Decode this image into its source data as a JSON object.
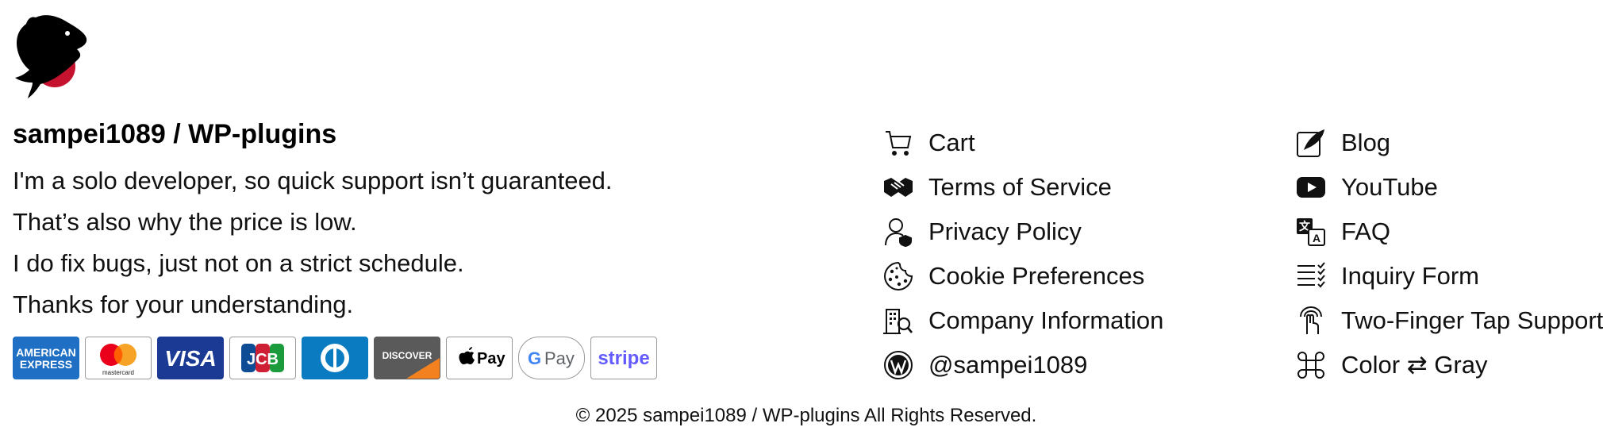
{
  "site": {
    "title": "sampei1089 / WP-plugins",
    "description": [
      "I'm a solo developer, so quick support isn’t guaranteed.",
      "That’s also why the price is low.",
      "I do fix bugs, just not on a strict schedule.",
      "Thanks for your understanding."
    ]
  },
  "payments": [
    {
      "name": "American Express",
      "icon": "amex-icon"
    },
    {
      "name": "Mastercard",
      "icon": "mastercard-icon",
      "text": "mastercard"
    },
    {
      "name": "Visa",
      "icon": "visa-icon",
      "text": "VISA"
    },
    {
      "name": "JCB",
      "icon": "jcb-icon",
      "text": "JCB"
    },
    {
      "name": "Diners Club",
      "icon": "diners-icon"
    },
    {
      "name": "Discover",
      "icon": "discover-icon",
      "text": "DISCOVER"
    },
    {
      "name": "Apple Pay",
      "icon": "apple-pay-icon",
      "text": "Pay"
    },
    {
      "name": "Google Pay",
      "icon": "google-pay-icon",
      "text": "Pay"
    },
    {
      "name": "Stripe",
      "icon": "stripe-icon",
      "text": "stripe"
    }
  ],
  "amex": {
    "line1": "AMERICAN",
    "line2": "EXPRESS"
  },
  "nav": {
    "col1": [
      {
        "label": "Cart",
        "icon": "cart-icon"
      },
      {
        "label": "Terms of Service",
        "icon": "handshake-icon"
      },
      {
        "label": "Privacy Policy",
        "icon": "user-shield-icon"
      },
      {
        "label": "Cookie Preferences",
        "icon": "cookie-icon"
      },
      {
        "label": "Company Information",
        "icon": "building-search-icon"
      },
      {
        "label": "@sampei1089",
        "icon": "wordpress-icon"
      }
    ],
    "col2": [
      {
        "label": "Blog",
        "icon": "quill-icon"
      },
      {
        "label": "YouTube",
        "icon": "youtube-icon"
      },
      {
        "label": "FAQ",
        "icon": "translate-icon"
      },
      {
        "label": "Inquiry Form",
        "icon": "checklist-icon"
      },
      {
        "label": "Two-Finger Tap Support",
        "icon": "two-finger-tap-icon"
      },
      {
        "label": "Color ⇄ Gray",
        "icon": "command-icon"
      }
    ]
  },
  "footer": {
    "copyright": "© 2025 sampei1089 / WP-plugins All Rights Reserved."
  },
  "colors": {
    "text": "#111111",
    "logo_red": "#c4122f",
    "amex_blue": "#1f6fc4",
    "visa_blue": "#1a3a94",
    "stripe_purple": "#635bff"
  }
}
